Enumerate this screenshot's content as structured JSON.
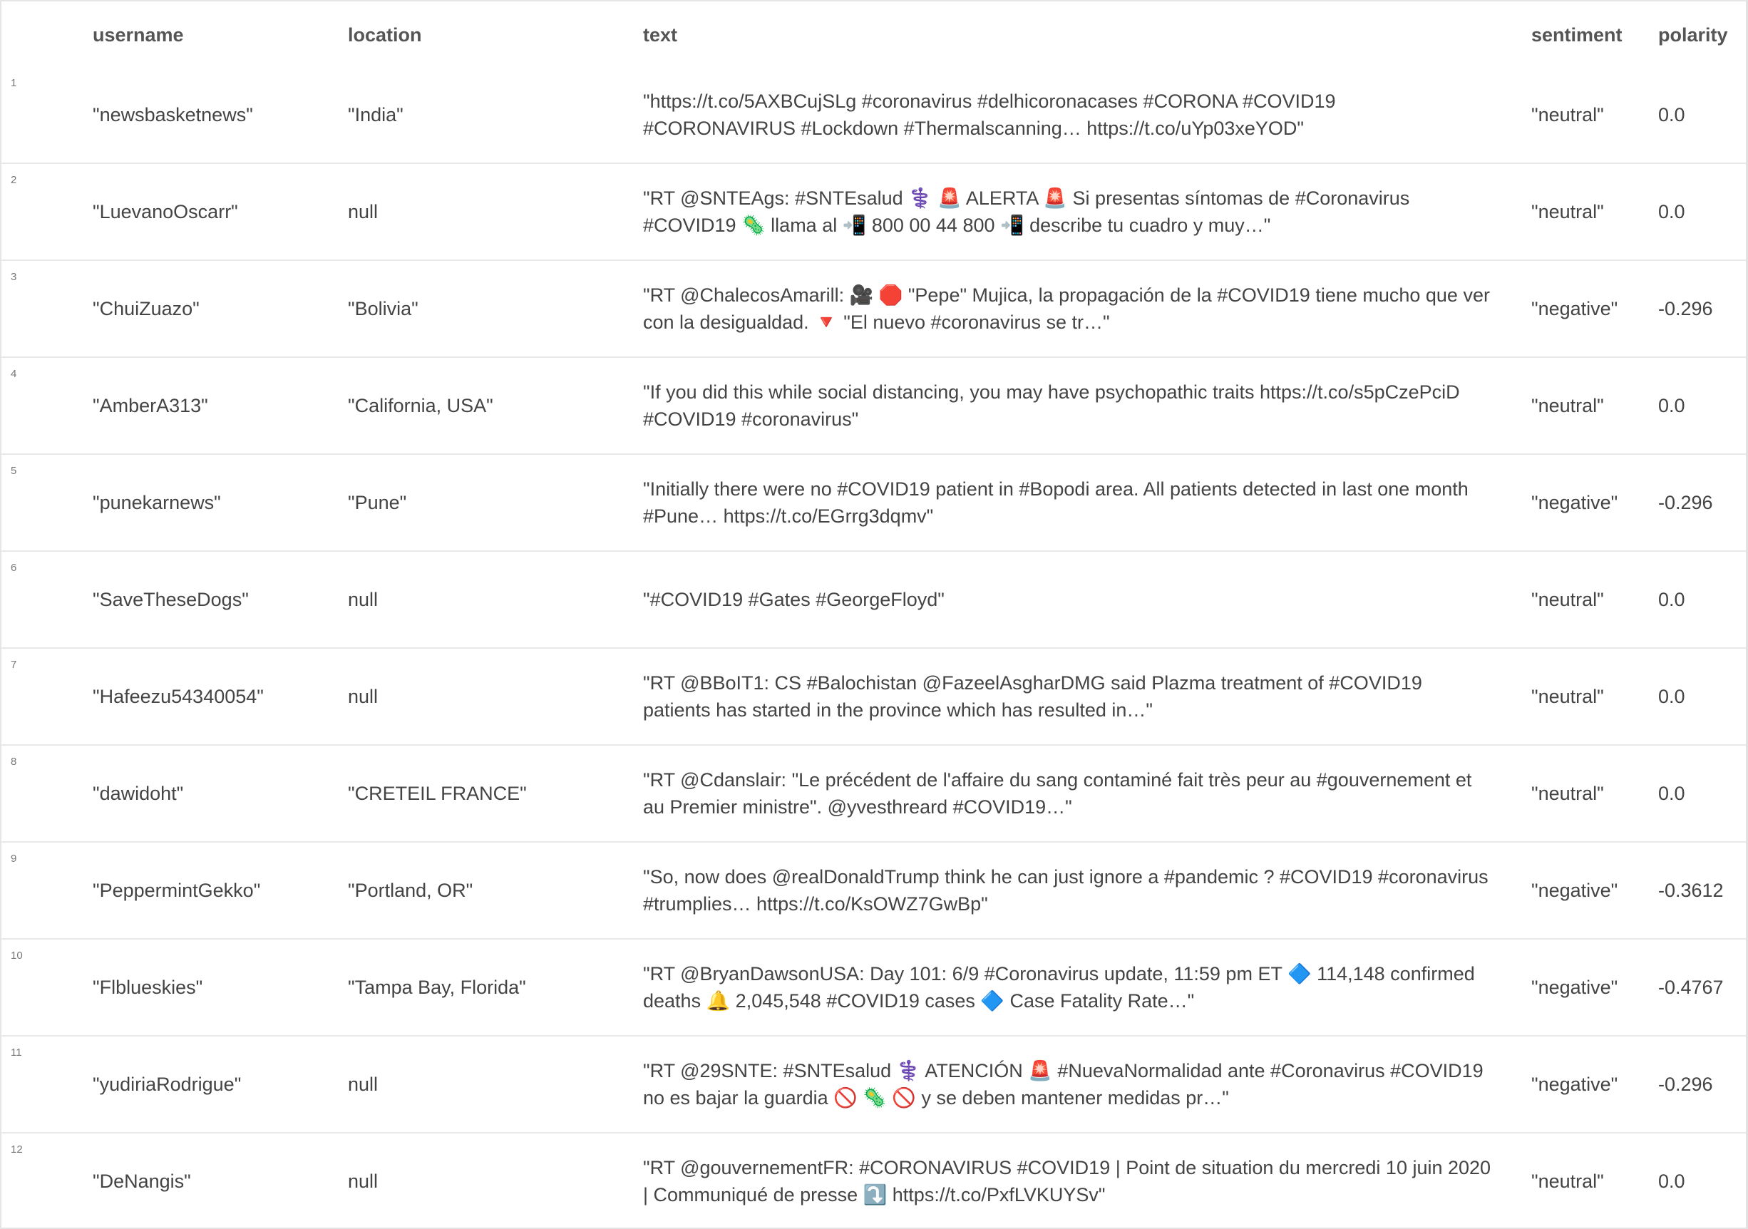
{
  "columns": {
    "username": "username",
    "location": "location",
    "text": "text",
    "sentiment": "sentiment",
    "polarity": "polarity"
  },
  "rows": [
    {
      "num": "1",
      "username": "\"newsbasketnews\"",
      "location": "\"India\"",
      "text": "\"https://t.co/5AXBCujSLg #coronavirus #delhicoronacases #CORONA #COVID19 #CORONAVIRUS #Lockdown #Thermalscanning… https://t.co/uYp03xeYOD\"",
      "sentiment": "\"neutral\"",
      "polarity": "0.0"
    },
    {
      "num": "2",
      "username": "\"LuevanoOscarr\"",
      "location": "null",
      "text": "\"RT @SNTEAgs: #SNTEsalud ⚕️ 🚨 ALERTA 🚨 Si presentas síntomas de #Coronavirus #COVID19 🦠 llama al 📲 800 00 44 800 📲 describe tu cuadro y muy…\"",
      "sentiment": "\"neutral\"",
      "polarity": "0.0"
    },
    {
      "num": "3",
      "username": "\"ChuiZuazo\"",
      "location": "\"Bolivia\"",
      "text": "\"RT @ChalecosAmarill: 🎥 🛑 \"Pepe\" Mujica, la propagación de la #COVID19 tiene mucho que ver con la desigualdad. 🔻 \"El nuevo #coronavirus se tr…\"",
      "sentiment": "\"negative\"",
      "polarity": "-0.296"
    },
    {
      "num": "4",
      "username": "\"AmberA313\"",
      "location": "\"California, USA\"",
      "text": "\"If you did this while social distancing, you may have psychopathic traits https://t.co/s5pCzePciD #COVID19 #coronavirus\"",
      "sentiment": "\"neutral\"",
      "polarity": "0.0"
    },
    {
      "num": "5",
      "username": "\"punekarnews\"",
      "location": "\"Pune\"",
      "text": "\"Initially there were no #COVID19 patient in #Bopodi area. All patients detected in last one month #Pune… https://t.co/EGrrg3dqmv\"",
      "sentiment": "\"negative\"",
      "polarity": "-0.296"
    },
    {
      "num": "6",
      "username": "\"SaveTheseDogs\"",
      "location": "null",
      "text": "\"#COVID19 #Gates #GeorgeFloyd\"",
      "sentiment": "\"neutral\"",
      "polarity": "0.0"
    },
    {
      "num": "7",
      "username": "\"Hafeezu54340054\"",
      "location": "null",
      "text": "\"RT @BBoIT1: CS #Balochistan @FazeelAsgharDMG said Plazma treatment of #COVID19 patients has started in the province which has resulted in…\"",
      "sentiment": "\"neutral\"",
      "polarity": "0.0"
    },
    {
      "num": "8",
      "username": "\"dawidoht\"",
      "location": "\"CRETEIL FRANCE\"",
      "text": "\"RT @Cdanslair: \"Le précédent de l'affaire du sang contaminé fait très peur au #gouvernement et au Premier ministre\". @yvesthreard #COVID19…\"",
      "sentiment": "\"neutral\"",
      "polarity": "0.0"
    },
    {
      "num": "9",
      "username": "\"PeppermintGekko\"",
      "location": "\"Portland, OR\"",
      "text": "\"So, now does @realDonaldTrump think he can just ignore a #pandemic ? #COVID19 #coronavirus #trumplies… https://t.co/KsOWZ7GwBp\"",
      "sentiment": "\"negative\"",
      "polarity": "-0.3612"
    },
    {
      "num": "10",
      "username": "\"Flblueskies\"",
      "location": "\"Tampa Bay, Florida\"",
      "text": "\"RT @BryanDawsonUSA: Day 101: 6/9 #Coronavirus update, 11:59 pm ET 🔷 114,148 confirmed deaths 🔔 2,045,548 #COVID19 cases 🔷 Case Fatality Rate…\"",
      "sentiment": "\"negative\"",
      "polarity": "-0.4767"
    },
    {
      "num": "11",
      "username": "\"yudiriaRodrigue\"",
      "location": "null",
      "text": "\"RT @29SNTE: #SNTEsalud ⚕️ ATENCIÓN 🚨 #NuevaNormalidad ante #Coronavirus #COVID19 no es bajar la guardia 🚫 🦠 🚫 y se deben mantener medidas pr…\"",
      "sentiment": "\"negative\"",
      "polarity": "-0.296"
    },
    {
      "num": "12",
      "username": "\"DeNangis\"",
      "location": "null",
      "text": "\"RT @gouvernementFR: #CORONAVIRUS #COVID19 | Point de situation du mercredi 10 juin 2020 | Communiqué de presse ⤵️ https://t.co/PxfLVKUYSv\"",
      "sentiment": "\"neutral\"",
      "polarity": "0.0"
    }
  ]
}
